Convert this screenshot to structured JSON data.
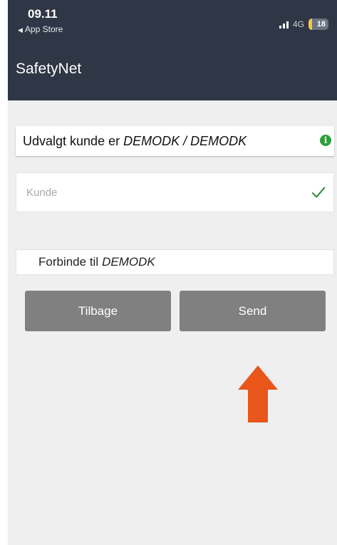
{
  "status_bar": {
    "time": "09.11",
    "back_label": "App Store",
    "network": "4G",
    "battery": "18"
  },
  "header": {
    "title": "SafetyNet"
  },
  "selected_customer": {
    "prefix": "Udvalgt kunde er",
    "value": "DEMODK / DEMODK",
    "icon": "info-icon"
  },
  "customer_field": {
    "placeholder": "Kunde",
    "value": "",
    "status_icon": "check-icon"
  },
  "connect": {
    "prefix": "Forbinde til",
    "target": "DEMODK"
  },
  "buttons": {
    "back_label": "Tilbage",
    "send_label": "Send"
  },
  "colors": {
    "header_bg": "#2f3746",
    "page_bg": "#efefef",
    "button_bg": "#808080",
    "success": "#2e9e3a",
    "annotation_arrow": "#e8561a"
  }
}
